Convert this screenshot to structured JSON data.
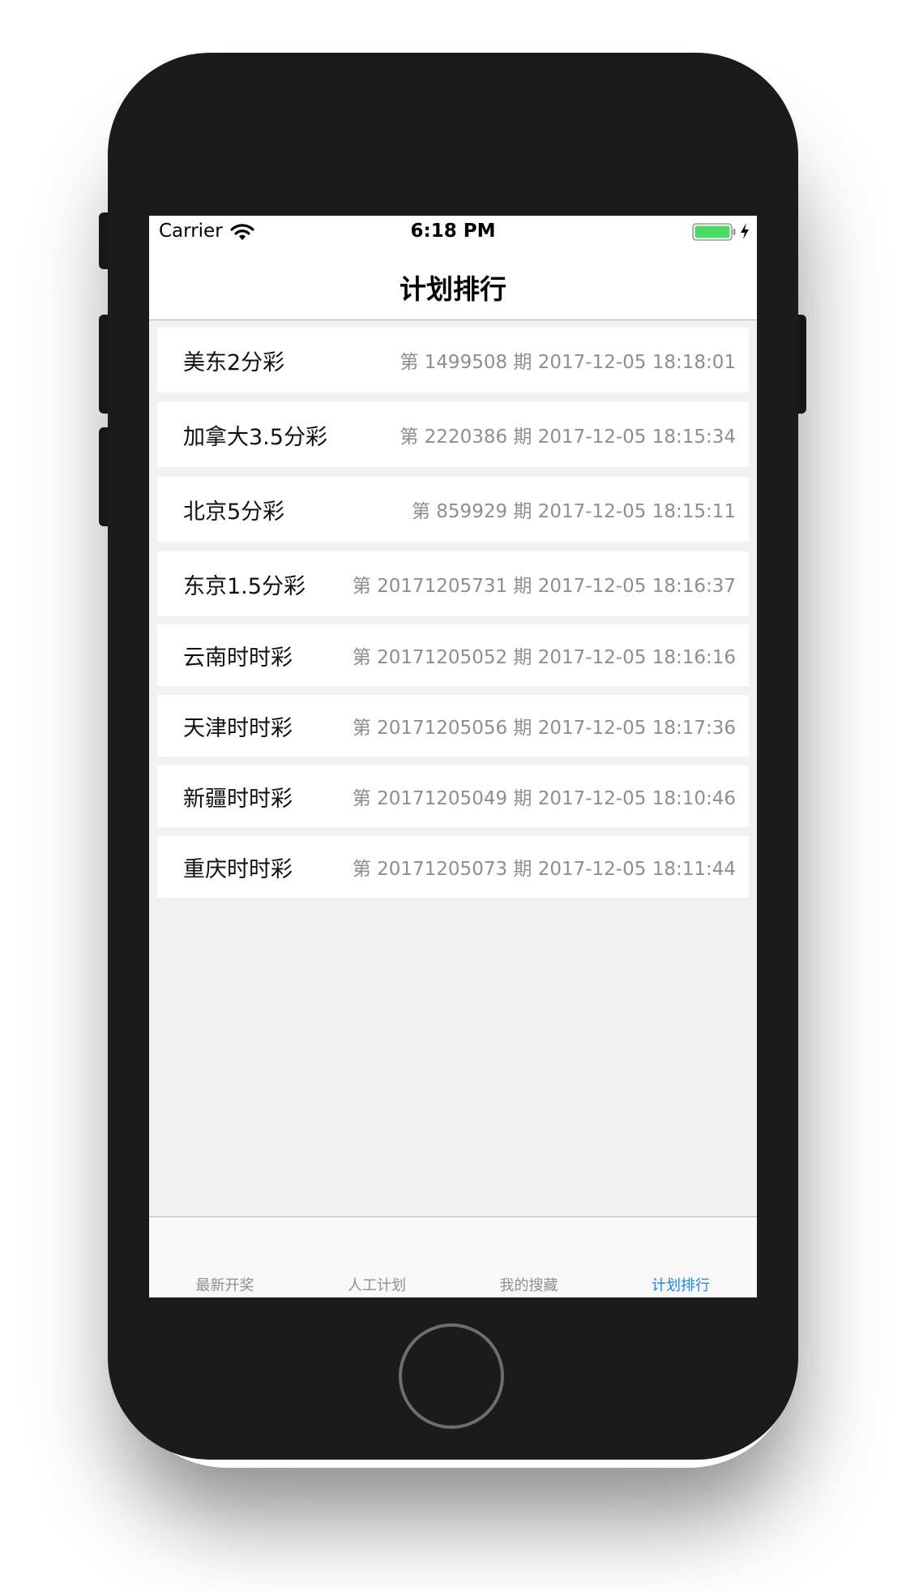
{
  "status_bar": {
    "carrier": "Carrier",
    "time": "6:18 PM",
    "battery_color": "#4cd964"
  },
  "nav": {
    "title": "计划排行"
  },
  "rows": [
    {
      "name": "美东2分彩",
      "info": "第 1499508 期 2017-12-05 18:18:01"
    },
    {
      "name": "加拿大3.5分彩",
      "info": "第 2220386 期 2017-12-05 18:15:34"
    },
    {
      "name": "北京5分彩",
      "info": "第 859929 期 2017-12-05 18:15:11"
    },
    {
      "name": "东京1.5分彩",
      "info": "第 20171205731 期 2017-12-05 18:16:37"
    },
    {
      "name": "云南时时彩",
      "info": "第 20171205052 期 2017-12-05 18:16:16"
    },
    {
      "name": "天津时时彩",
      "info": "第 20171205056 期 2017-12-05 18:17:36"
    },
    {
      "name": "新疆时时彩",
      "info": "第 20171205049 期 2017-12-05 18:10:46"
    },
    {
      "name": "重庆时时彩",
      "info": "第 20171205073 期 2017-12-05 18:11:44"
    }
  ],
  "tabs": [
    {
      "label": "最新开奖",
      "active": false
    },
    {
      "label": "人工计划",
      "active": false
    },
    {
      "label": "我的搜藏",
      "active": false
    },
    {
      "label": "计划排行",
      "active": true
    }
  ],
  "colors": {
    "accent": "#1d86e8",
    "inactive_tab": "#8f8f8f",
    "secondary_text": "#8e8e8e",
    "background": "#f1f1f1"
  }
}
